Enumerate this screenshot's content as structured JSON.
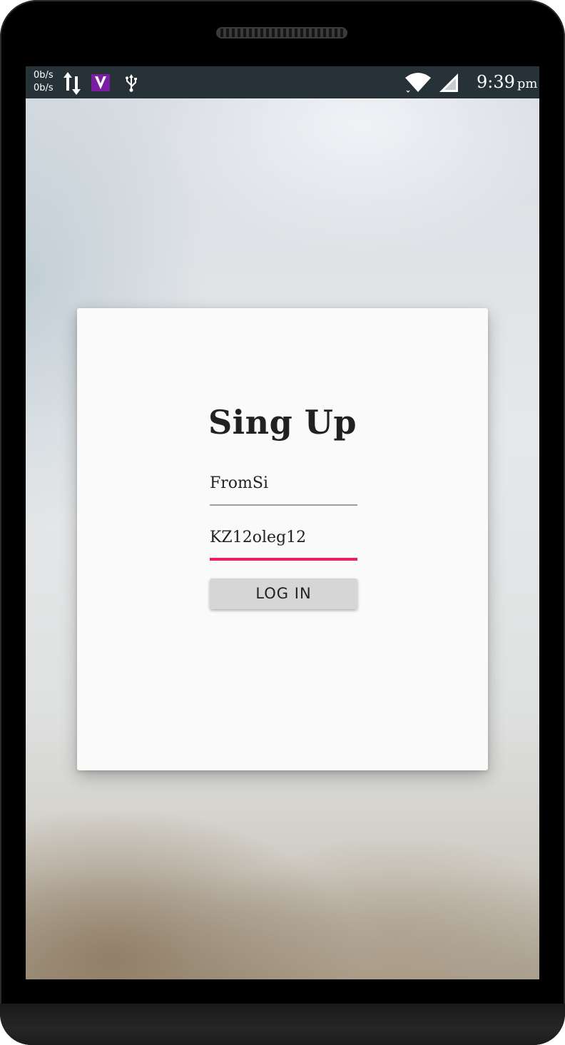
{
  "status_bar": {
    "upload_speed": "0b/s",
    "download_speed": "0b/s",
    "app_icon_letter": "V",
    "time": "9:39",
    "ampm": "pm",
    "icons": [
      "data-transfer-icon",
      "app-notification-icon",
      "usb-icon",
      "wifi-icon",
      "cell-signal-icon"
    ],
    "background_color": "#263238"
  },
  "card": {
    "title": "Sing Up",
    "username_value": "FromSi",
    "password_value": "KZ12oleg12",
    "login_button_label": "LOG IN",
    "accent_color": "#e91e63"
  }
}
